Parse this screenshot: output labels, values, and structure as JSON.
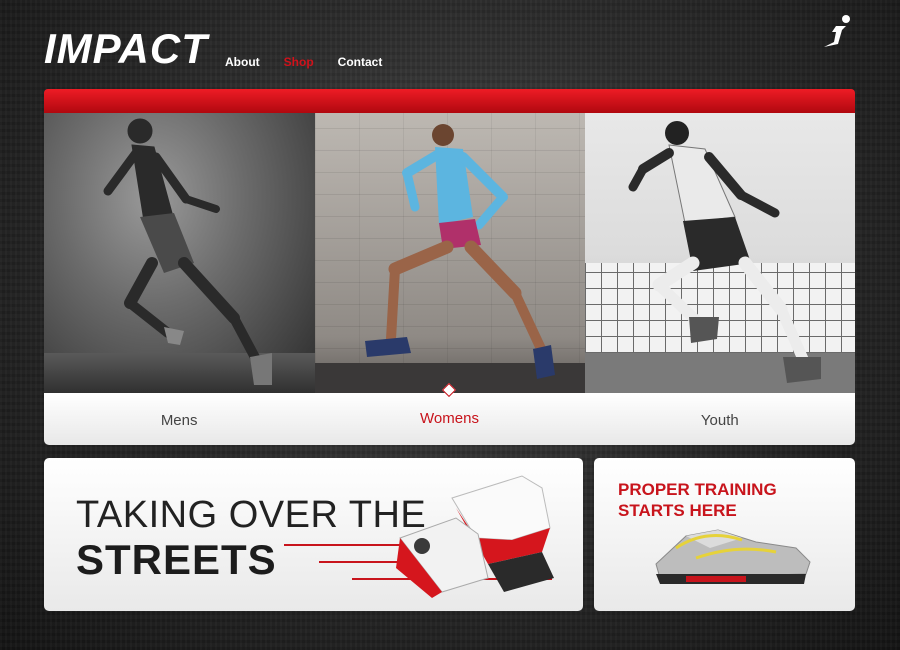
{
  "header": {
    "logo": "IMPACT",
    "nav": [
      {
        "label": "About",
        "active": false
      },
      {
        "label": "Shop",
        "active": true
      },
      {
        "label": "Contact",
        "active": false
      }
    ],
    "brand_icon": "runner-i-icon"
  },
  "colors": {
    "accent": "#d0121b",
    "text": "#444444",
    "background": "#2c2c2c"
  },
  "hero": {
    "panels": [
      {
        "image": "mens-runner-photo"
      },
      {
        "image": "womens-runner-photo"
      },
      {
        "image": "youth-runner-photo"
      }
    ],
    "tabs": [
      {
        "label": "Mens",
        "active": false
      },
      {
        "label": "Womens",
        "active": true
      },
      {
        "label": "Youth",
        "active": false
      }
    ]
  },
  "promo_main": {
    "line1": "TAKING OVER THE",
    "line2": "STREETS",
    "image": "red-white-sneakers-photo"
  },
  "promo_side": {
    "headline": "PROPER TRAINING STARTS HERE",
    "image": "silver-yellow-sneaker-photo"
  }
}
